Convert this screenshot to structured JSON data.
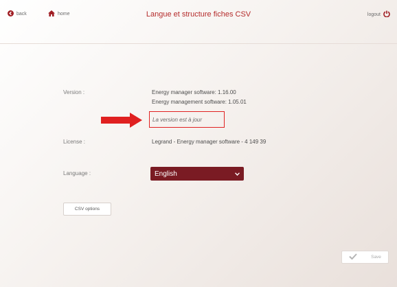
{
  "header": {
    "back_label": "back",
    "home_label": "home",
    "title": "Langue et structure fiches CSV",
    "logout_label": "logout"
  },
  "version": {
    "label": "Version :",
    "line1": "Energy manager software: 1.16.00",
    "line2": "Energy management software: 1.05.01",
    "status": "La version est à jour"
  },
  "license": {
    "label": "License :",
    "value": "Legrand - Energy manager software - 4 149 39"
  },
  "language": {
    "label": "Language :",
    "selected": "English"
  },
  "buttons": {
    "csv_options": "CSV options",
    "save": "Save"
  },
  "colors": {
    "accent": "#b42a2a",
    "select_bg": "#7a1b23",
    "highlight": "#e02020"
  }
}
